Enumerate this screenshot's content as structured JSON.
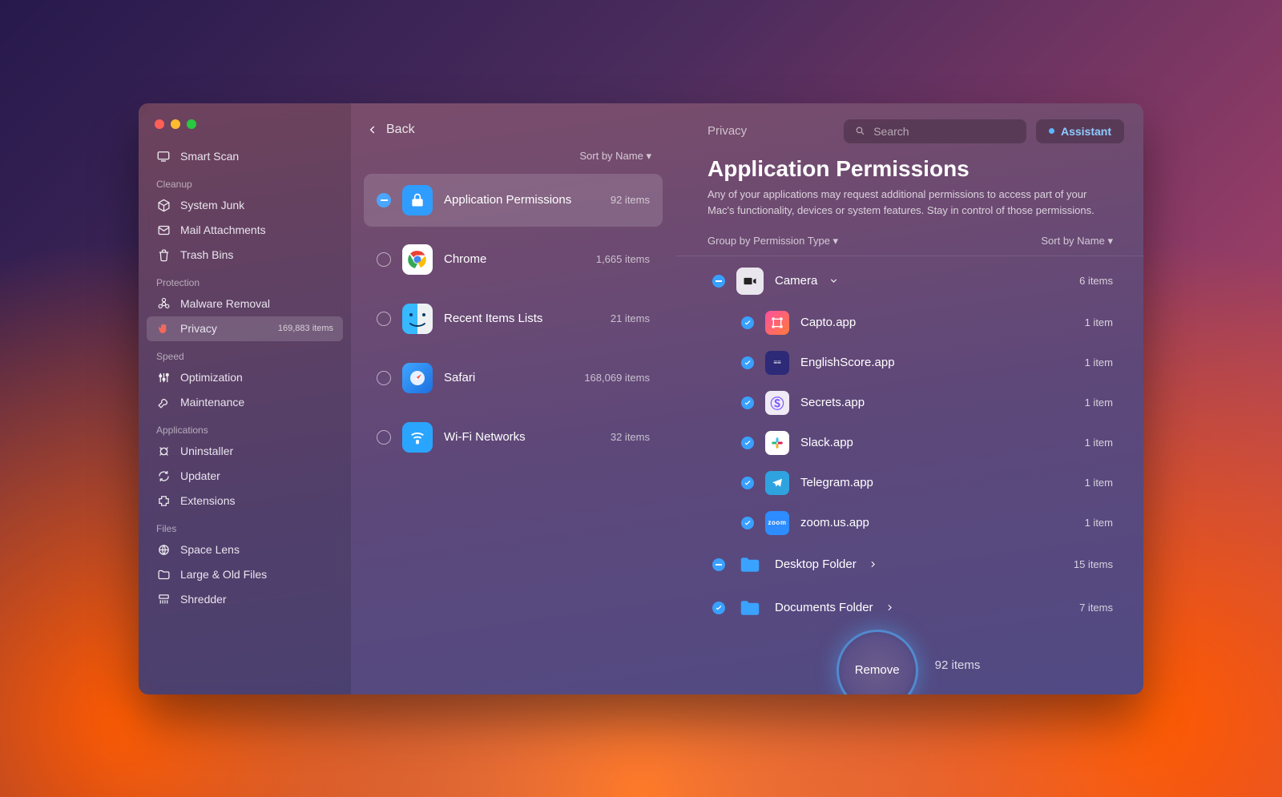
{
  "sidebar": {
    "smart_scan": "Smart Scan",
    "sections": {
      "cleanup": "Cleanup",
      "protection": "Protection",
      "speed": "Speed",
      "applications": "Applications",
      "files": "Files"
    },
    "items": {
      "system_junk": "System Junk",
      "mail_attachments": "Mail Attachments",
      "trash_bins": "Trash Bins",
      "malware_removal": "Malware Removal",
      "privacy": "Privacy",
      "privacy_count": "169,883 items",
      "optimization": "Optimization",
      "maintenance": "Maintenance",
      "uninstaller": "Uninstaller",
      "updater": "Updater",
      "extensions": "Extensions",
      "space_lens": "Space Lens",
      "large_old": "Large & Old Files",
      "shredder": "Shredder"
    }
  },
  "middle": {
    "back": "Back",
    "sort": "Sort by Name ▾",
    "items": [
      {
        "label": "Application Permissions",
        "meta": "92 items"
      },
      {
        "label": "Chrome",
        "meta": "1,665 items"
      },
      {
        "label": "Recent Items Lists",
        "meta": "21 items"
      },
      {
        "label": "Safari",
        "meta": "168,069 items"
      },
      {
        "label": "Wi-Fi Networks",
        "meta": "32 items"
      }
    ]
  },
  "right": {
    "breadcrumb": "Privacy",
    "search_placeholder": "Search",
    "assistant": "Assistant",
    "title": "Application Permissions",
    "desc": "Any of your applications may request additional permissions to access part of your Mac's functionality, devices or system features. Stay in control of those permissions.",
    "group_by": "Group by Permission Type ▾",
    "sort_by": "Sort by Name ▾",
    "groups": [
      {
        "name": "Camera",
        "count": "6 items",
        "expanded": true,
        "state": "minus",
        "children": [
          {
            "name": "Capto.app",
            "count": "1 item"
          },
          {
            "name": "EnglishScore.app",
            "count": "1 item"
          },
          {
            "name": "Secrets.app",
            "count": "1 item"
          },
          {
            "name": "Slack.app",
            "count": "1 item"
          },
          {
            "name": "Telegram.app",
            "count": "1 item"
          },
          {
            "name": "zoom.us.app",
            "count": "1 item"
          }
        ]
      },
      {
        "name": "Desktop Folder",
        "count": "15 items",
        "expanded": false,
        "state": "minus"
      },
      {
        "name": "Documents Folder",
        "count": "7 items",
        "expanded": false,
        "state": "check"
      }
    ],
    "remove": "Remove",
    "footer_count": "92 items"
  },
  "icons": {
    "colors": {
      "app_permissions": "#2f9dff",
      "chrome": "#fff",
      "finder": "linear-gradient(90deg,#3dbcff 50%,#f5f5f5 50%)",
      "safari": "linear-gradient(135deg,#3fa6ff,#1d6fe0)",
      "wifi": "#2aa5ff",
      "capto": "linear-gradient(135deg,#ff4fa0,#ff7a3c)",
      "english": "#2d2a78",
      "secrets": "#efeaf6",
      "slack": "#fff",
      "telegram": "#2fa3e0",
      "zoom": "#2d8cff",
      "folder": "#3aa2ff"
    }
  }
}
